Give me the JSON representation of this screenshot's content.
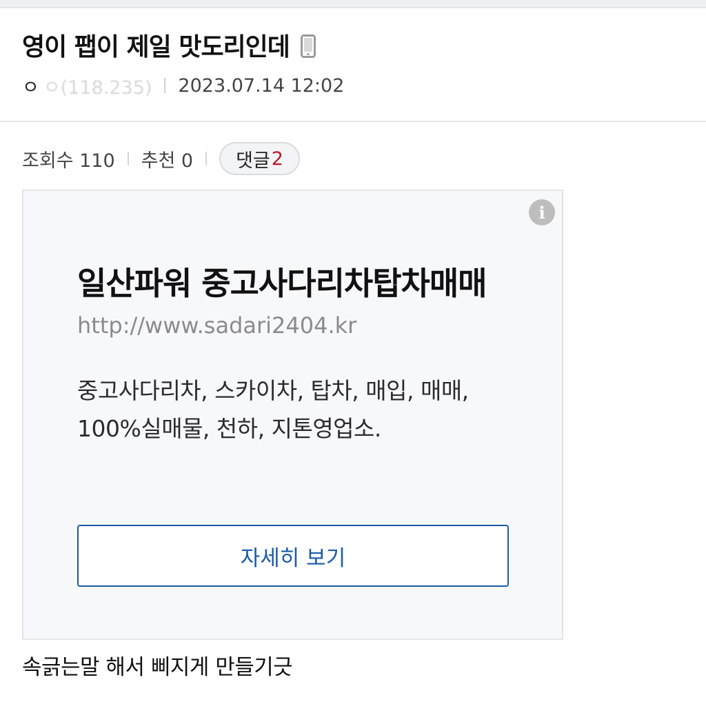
{
  "post": {
    "title": "영이 팹이 제일 맛도리인데",
    "device_icon": "mobile-phone-icon",
    "author": "ㅇ",
    "author_ip": "ㅇ(118.235)",
    "date": "2023.07.14 12:02",
    "views_label": "조회수 110",
    "recommend_label": "추천 0",
    "comments_label": "댓글",
    "comments_count": "2",
    "body": "속긁는말 해서 삐지게 만들기긋"
  },
  "ad": {
    "title": "일산파워 중고사다리차탑차매매",
    "url": "http://www.sadari2404.kr",
    "description": "중고사다리차, 스카이차, 탑차, 매입, 매매, 100%실매물, 천하, 지톤영업소.",
    "button_label": "자세히 보기",
    "info_icon": "info-icon",
    "info_glyph": "i"
  },
  "colors": {
    "accent_blue": "#1a5ba6",
    "comment_count_red": "#c0182b",
    "ad_background": "#f7f8fa"
  }
}
